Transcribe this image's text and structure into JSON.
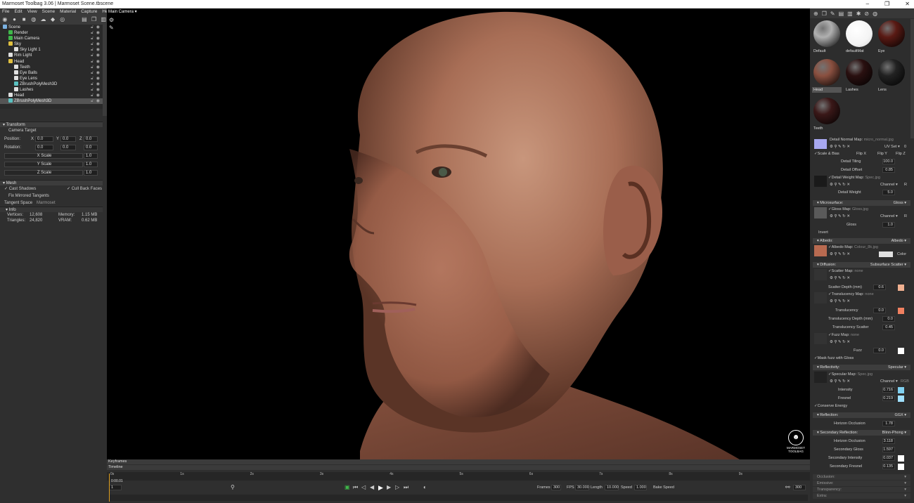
{
  "window": {
    "title": "Marmoset Toolbag 3.06  |  Marmoset Scene.tbscene",
    "minimize": "–",
    "maximize": "❐",
    "close": "✕"
  },
  "menu": [
    "File",
    "Edit",
    "View",
    "Scene",
    "Material",
    "Capture",
    "Help"
  ],
  "tree": [
    {
      "label": "Scene",
      "indent": 0,
      "color": "#7ab0e0"
    },
    {
      "label": "Render",
      "indent": 1,
      "color": "#3fb84a"
    },
    {
      "label": "Main Camera",
      "indent": 1,
      "color": "#3fb84a"
    },
    {
      "label": "Sky",
      "indent": 1,
      "color": "#e0c040"
    },
    {
      "label": "Sky Light 1",
      "indent": 2,
      "color": "#e0e0e0"
    },
    {
      "label": "Rim Light",
      "indent": 1,
      "color": "#e0e0e0"
    },
    {
      "label": "Head",
      "indent": 1,
      "color": "#e0c040"
    },
    {
      "label": "Teeth",
      "indent": 2,
      "color": "#e0e0e0"
    },
    {
      "label": "Eye Balls",
      "indent": 2,
      "color": "#e0e0e0"
    },
    {
      "label": "Eye Lens",
      "indent": 2,
      "color": "#e0e0e0"
    },
    {
      "label": "ZBrushPolyMesh3D",
      "indent": 2,
      "color": "#5ac0c0"
    },
    {
      "label": "Lashes",
      "indent": 2,
      "color": "#e0e0e0"
    },
    {
      "label": "Head",
      "indent": 1,
      "color": "#e0e0e0"
    },
    {
      "label": "ZBrushPolyMesh3D",
      "indent": 1,
      "color": "#5ac0c0",
      "selected": true
    }
  ],
  "transform": {
    "section": "Transform",
    "camera_target": "Camera Target",
    "position_label": "Position:",
    "rotation_label": "Rotation:",
    "x": "X",
    "y": "Y",
    "z": "Z",
    "pos": [
      "0.0",
      "0.0",
      "0.0"
    ],
    "rot": [
      "0.0",
      "0.0",
      "0.0"
    ],
    "xscale_label": "X Scale",
    "yscale_label": "Y Scale",
    "zscale_label": "Z Scale",
    "xscale": "1.0",
    "yscale": "1.0",
    "zscale": "1.0"
  },
  "mesh": {
    "section": "Mesh",
    "cast_shadows": "Cast Shadows",
    "cull_back": "Cull Back Faces",
    "fix_mirrored": "Fix Mirrored Tangents",
    "tangent_label": "Tangent Space",
    "tangent_value": "Marmoset",
    "info": "Info",
    "vertices_label": "Vertices:",
    "vertices": "12,608",
    "triangles_label": "Triangles:",
    "triangles": "24,820",
    "memory_label": "Memory:",
    "memory": "1.15 MB",
    "vram_label": "VRAM:",
    "vram": "0.62 MB"
  },
  "viewport": {
    "camera": "Main Camera ▾",
    "logo_text": "MARMOSET TOOLBAG"
  },
  "materials": [
    {
      "label": "Default",
      "color": "#b0b0b0"
    },
    {
      "label": "defaultMat",
      "color": "#ffffff"
    },
    {
      "label": "Eye",
      "color": "#5a1a14"
    },
    {
      "label": "Head",
      "color": "#8a5040",
      "selected": true
    },
    {
      "label": "Lashes",
      "color": "#2a1010"
    },
    {
      "label": "Lens",
      "color": "#222222"
    },
    {
      "label": "Teeth",
      "color": "#3a1818"
    }
  ],
  "props": {
    "detail_normal_map": "Detail Normal Map:",
    "detail_normal_file": "micro_normal.jpg",
    "uv_set": "UV Set ▾",
    "uv_val": "0",
    "scale_bias": "Scale & Bias",
    "flip_x": "Flip X",
    "flip_y": "Flip Y",
    "flip_z": "Flip Z",
    "detail_tiling": "Detail Tiling",
    "detail_tiling_v": "100.0",
    "detail_offset": "Detail Offset",
    "detail_offset_v": "0.85",
    "detail_weight_map": "Detail Weight Map:",
    "detail_weight_file": "Spec.jpg",
    "channel": "Channel ▾",
    "channel_r": "R",
    "detail_weight": "Detail Weight",
    "detail_weight_v": "5.0",
    "microsurface": "Microsurface:",
    "gloss_tag": "Gloss ▾",
    "gloss_map": "Gloss Map:",
    "gloss_file": "Gloss.jpg",
    "gloss": "Gloss",
    "gloss_v": "1.0",
    "invert": "Invert",
    "albedo": "Albedo:",
    "albedo_tag": "Albedo ▾",
    "albedo_map": "Albedo Map:",
    "albedo_file": "Colour_8k.jpg",
    "color": "Color",
    "diffusion": "Diffusion:",
    "diffusion_tag": "Subsurface Scatter ▾",
    "scatter_map": "Scatter Map:",
    "none": "none",
    "scatter_depth": "Scatter Depth (mm)",
    "scatter_depth_v": "0.6",
    "translucency_map": "Translucency Map:",
    "translucency": "Translucency",
    "translucency_v": "0.0",
    "translucency_depth": "Translucency Depth (mm)",
    "translucency_depth_v": "0.0",
    "translucency_scatter": "Translucency Scatter",
    "translucency_scatter_v": "0.45",
    "fuzz_map": "Fuzz Map:",
    "fuzz": "Fuzz",
    "fuzz_v": "0.0",
    "mask_fuzz": "Mask fuzz with Gloss",
    "reflectivity": "Reflectivity:",
    "reflectivity_tag": "Specular ▾",
    "specular_map": "Specular Map:",
    "specular_file": "Spec.jpg",
    "rgb": "RGB",
    "intensity": "Intensity",
    "intensity_v": "0.716",
    "fresnel": "Fresnel",
    "fresnel_v": "0.219",
    "conserve": "Conserve Energy",
    "reflection": "Reflection:",
    "reflection_tag": "GGX ▾",
    "horizon_occlusion": "Horizon Occlusion",
    "horizon_occlusion_v": "1.78",
    "secondary_reflection": "Secondary Reflection:",
    "secondary_tag": "Blinn-Phong ▾",
    "horizon_occlusion2_v": "3.118",
    "secondary_gloss": "Secondary Gloss",
    "secondary_gloss_v": "1.597",
    "secondary_intensity": "Secondary Intensity",
    "secondary_intensity_v": "0.037",
    "secondary_fresnel": "Secondary Fresnel",
    "secondary_fresnel_v": "0.135",
    "occlusion": "Occlusion:",
    "emissive": "Emissive:",
    "transparency": "Transparency:",
    "extra": "Extra:"
  },
  "colors": {
    "scatter": "#f0b090",
    "translucency": "#f08060",
    "intensity": "#80d0f0",
    "fresnel": "#a0e0ff",
    "albedo_swatch": "#e0e0e0",
    "detail_normal": "#a8a8f0",
    "fuzz": "#ffffff",
    "sec_int": "#ffffff",
    "sec_fres": "#ffffff"
  },
  "timeline": {
    "keyframes": "Keyframes",
    "timeline": "Timeline",
    "current_time": "0:00.01",
    "frame": "1",
    "ticks": [
      "0s",
      "1s",
      "2s",
      "3s",
      "4s",
      "5s",
      "6s",
      "7s",
      "8s",
      "9s"
    ],
    "frames_label": "Frames",
    "frames": "300",
    "fps_label": "FPS",
    "fps": "30.000",
    "length_label": "Length",
    "length": "10.000",
    "speed_label": "Speed",
    "speed": "1.000",
    "bake": "Bake Speed",
    "end": "300"
  }
}
